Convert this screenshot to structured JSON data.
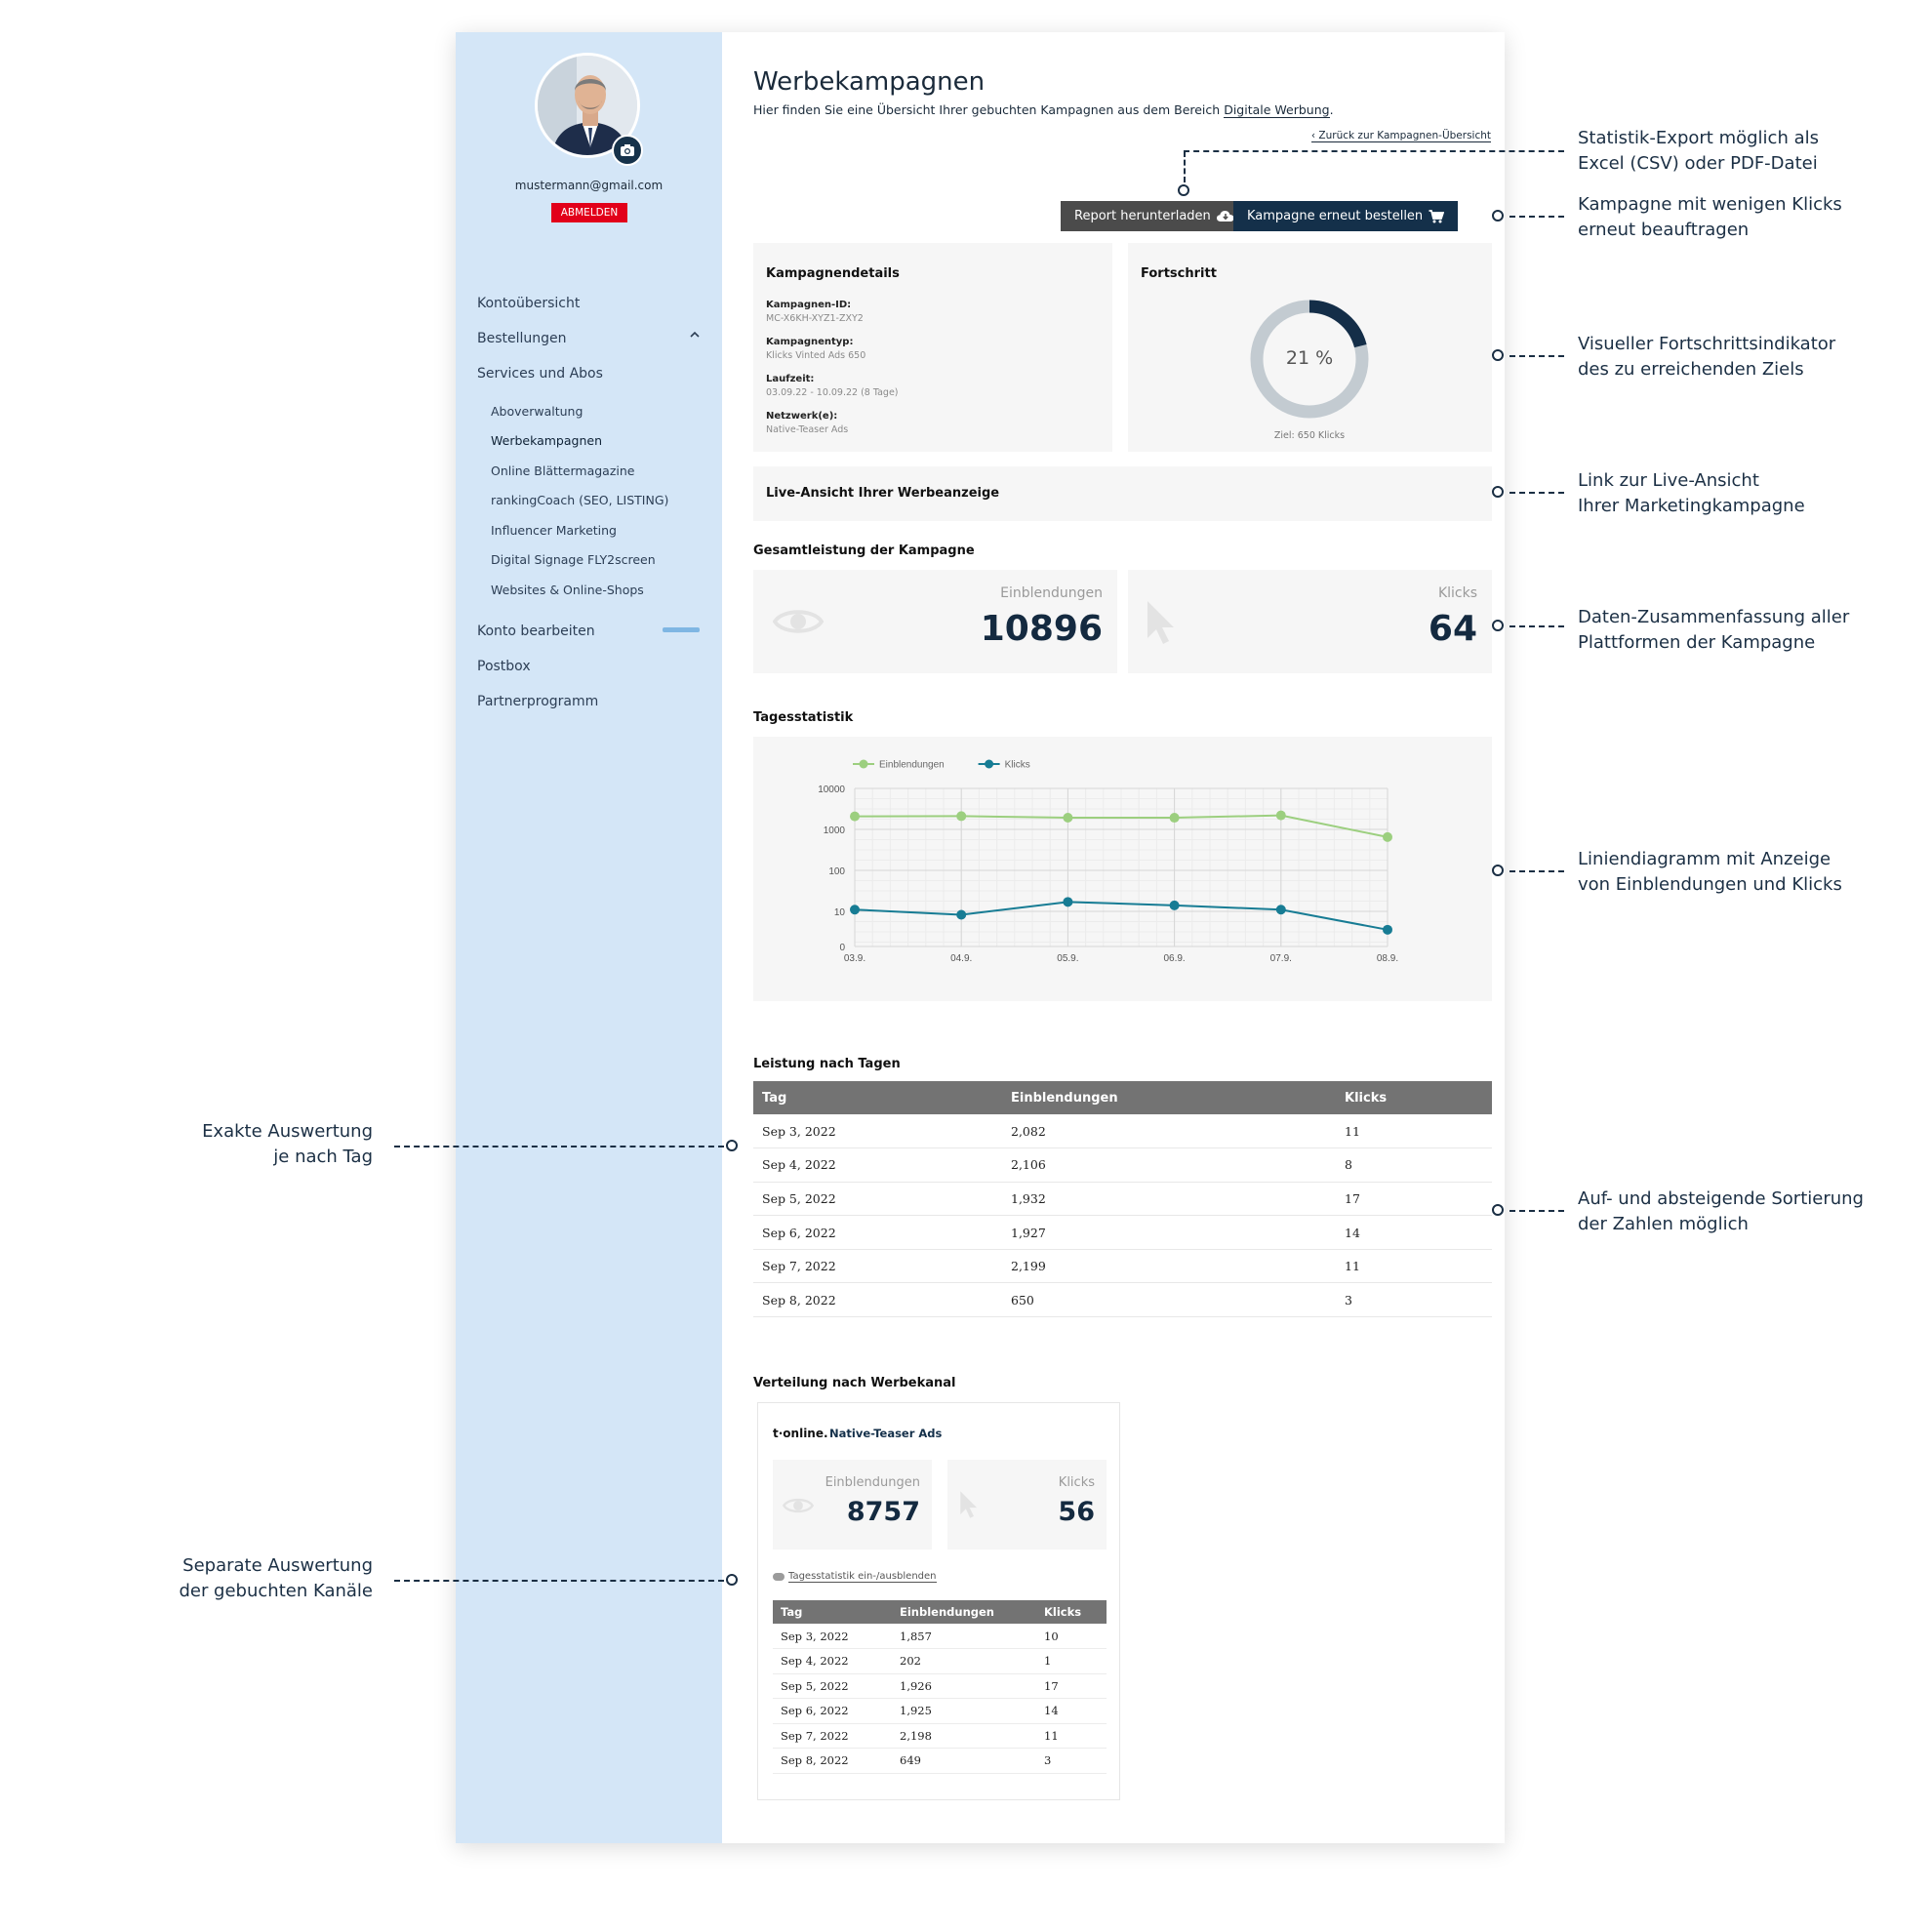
{
  "sidebar": {
    "email": "mustermann@gmail.com",
    "logout": "ABMELDEN",
    "nav": [
      "Kontoübersicht",
      "Bestellungen",
      "Services und Abos"
    ],
    "subnav": [
      "Aboverwaltung",
      "Werbekampagnen",
      "Online Blättermagazine",
      "rankingCoach (SEO, LISTING)",
      "Influencer Marketing",
      "Digital Signage FLY2screen",
      "Websites & Online-Shops"
    ],
    "nav_bottom": [
      "Konto bearbeiten",
      "Postbox",
      "Partnerprogramm"
    ]
  },
  "main": {
    "title": "Werbekampagnen",
    "intro": "Hier finden Sie eine Übersicht Ihrer gebuchten Kampagnen aus dem Bereich",
    "intro_link": "Digitale Werbung",
    "intro_end": ".",
    "back_link": "Zurück zur Kampagnen-Übersicht",
    "btn_report": "Report herunterladen",
    "btn_reorder": "Kampagne erneut bestellen"
  },
  "details": {
    "title": "Kampagnendetails",
    "id_label": "Kampagnen-ID:",
    "id_value": "MC-X6KH-XYZ1-ZXY2",
    "type_label": "Kampagnentyp:",
    "type_value": "Klicks Vinted Ads 650",
    "runtime_label": "Laufzeit:",
    "runtime_value": "03.09.22 - 10.09.22 (8 Tage)",
    "network_label": "Netzwerk(e):",
    "network_value": "Native-Teaser Ads"
  },
  "progress": {
    "title": "Fortschritt",
    "value": 0.21,
    "label": "21 %",
    "goal": "Ziel: 650 Klicks"
  },
  "live": {
    "title": "Live-Ansicht Ihrer Werbeanzeige"
  },
  "total": {
    "title": "Gesamtleistung der Kampagne",
    "impressions_label": "Einblendungen",
    "impressions": "10896",
    "clicks_label": "Klicks",
    "clicks": "64"
  },
  "daily_title": "Tagesstatistik",
  "chart_data": {
    "type": "line",
    "title": "",
    "xlabel": "",
    "ylabel": "",
    "yscale": "log",
    "y_ticks": [
      "10000",
      "1000",
      "100",
      "10",
      "0"
    ],
    "x": [
      "03.9.",
      "04.9.",
      "05.9.",
      "06.9.",
      "07.9.",
      "08.9."
    ],
    "legend_position": "top-left",
    "grid": true,
    "series": [
      {
        "name": "Einblendungen",
        "color": "#9ccf7f",
        "values": [
          2082,
          2106,
          1932,
          1927,
          2199,
          650
        ]
      },
      {
        "name": "Klicks",
        "color": "#177c94",
        "values": [
          11,
          8,
          17,
          14,
          11,
          3
        ]
      }
    ]
  },
  "table": {
    "title": "Leistung nach Tagen",
    "headers": [
      "Tag",
      "Einblendungen",
      "Klicks"
    ],
    "rows": [
      [
        "Sep 3, 2022",
        "2,082",
        "11"
      ],
      [
        "Sep 4, 2022",
        "2,106",
        "8"
      ],
      [
        "Sep 5, 2022",
        "1,932",
        "17"
      ],
      [
        "Sep 6, 2022",
        "1,927",
        "14"
      ],
      [
        "Sep 7, 2022",
        "2,199",
        "11"
      ],
      [
        "Sep 8, 2022",
        "650",
        "3"
      ]
    ]
  },
  "channel": {
    "title": "Verteilung nach Werbekanal",
    "logo": "t·online.",
    "name": "Native-Teaser Ads",
    "impressions_label": "Einblendungen",
    "impressions": "8757",
    "clicks_label": "Klicks",
    "clicks": "56",
    "toggle": "Tagesstatistik ein-/ausblenden",
    "headers": [
      "Tag",
      "Einblendungen",
      "Klicks"
    ],
    "rows": [
      [
        "Sep 3, 2022",
        "1,857",
        "10"
      ],
      [
        "Sep 4, 2022",
        "202",
        "1"
      ],
      [
        "Sep 5, 2022",
        "1,926",
        "17"
      ],
      [
        "Sep 6, 2022",
        "1,925",
        "14"
      ],
      [
        "Sep 7, 2022",
        "2,198",
        "11"
      ],
      [
        "Sep 8, 2022",
        "649",
        "3"
      ]
    ]
  },
  "annotations": {
    "export": [
      "Statistik-Export möglich als",
      "Excel (CSV) oder PDF-Datei"
    ],
    "reorder": [
      "Kampagne mit wenigen Klicks",
      "erneut beauftragen"
    ],
    "progress": [
      "Visueller Fortschrittsindikator",
      "des zu erreichenden Ziels"
    ],
    "live": [
      "Link zur Live-Ansicht",
      "Ihrer Marketingkampagne"
    ],
    "summary": [
      "Daten-Zusammenfassung aller",
      "Plattformen der Kampagne"
    ],
    "chart": [
      "Liniendiagramm mit Anzeige",
      "von Einblendungen und Klicks"
    ],
    "sorting": [
      "Auf- und absteigende Sortierung",
      "der Zahlen möglich"
    ],
    "daily": [
      "Exakte Auswertung",
      "je nach Tag"
    ],
    "channels": [
      "Separate Auswertung",
      "der gebuchten Kanäle"
    ]
  }
}
